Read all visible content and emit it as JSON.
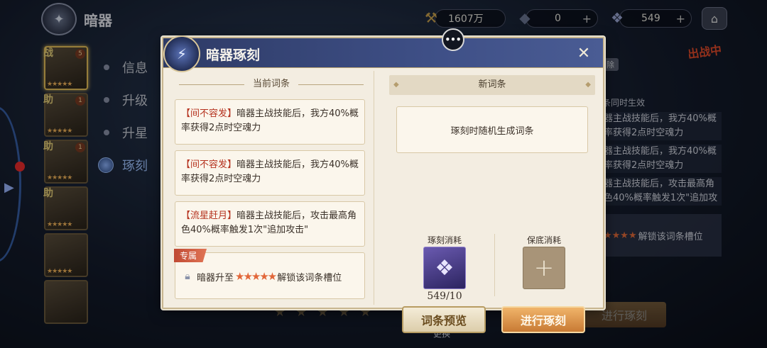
{
  "screen": {
    "title": "暗器",
    "title_icon": "dart-emblem-icon",
    "resources": [
      {
        "icon": "hammer-icon",
        "value": "1607万",
        "has_plus": false
      },
      {
        "icon": "ore-icon",
        "value": "0",
        "has_plus": true
      },
      {
        "icon": "crystal-icon",
        "value": "549",
        "has_plus": true
      }
    ],
    "home_icon": "home-icon",
    "card_tags": [
      "战",
      "助",
      "助",
      "助"
    ],
    "card_badges": [
      "5",
      "1",
      "1"
    ],
    "nav": [
      {
        "label": "信息",
        "active": false
      },
      {
        "label": "升级",
        "active": false
      },
      {
        "label": "升星",
        "active": false
      },
      {
        "label": "琢刻",
        "active": true
      }
    ],
    "in_battle": "出战中",
    "right_panel": {
      "tag": "除",
      "head": "条同时生效",
      "lines": [
        "器主战技能后，我方40%概率获得2点时空魂力",
        "器主战技能后，我方40%概率获得2点时空魂力",
        "器主战技能后，攻击最高角色40%概率触发1次\"追加攻击\""
      ],
      "lock_text": "解锁该词条槽位",
      "lock_stars": "★★★★"
    },
    "bg_carve_button": "进行琢刻",
    "bg_stars": "★★★★★",
    "swap_label": "更换",
    "accent_color": "#3e4f86"
  },
  "modal": {
    "title": "暗器琢刻",
    "close_icon": "close-icon",
    "current_title": "当前词条",
    "entries": [
      {
        "tag": "【间不容发】",
        "text": "暗器主战技能后，我方40%概率获得2点时空魂力"
      },
      {
        "tag": "【间不容发】",
        "text": "暗器主战技能后，我方40%概率获得2点时空魂力"
      },
      {
        "tag": "【流星赶月】",
        "text": "暗器主战技能后，攻击最高角色40%概率触发1次\"追加攻击\""
      }
    ],
    "exclusive": {
      "tag": "专属",
      "prefix": "暗器升至",
      "stars": "★★★★★",
      "suffix": "解锁该词条槽位"
    },
    "new_title": "新词条",
    "new_placeholder": "琢刻时随机生成词条",
    "carve_cost_label": "琢刻消耗",
    "carve_cost_count": "549/10",
    "guarantee_label": "保底消耗",
    "preview_button": "词条预览",
    "carve_button": "进行琢刻",
    "tag_color": "#b5321e"
  }
}
